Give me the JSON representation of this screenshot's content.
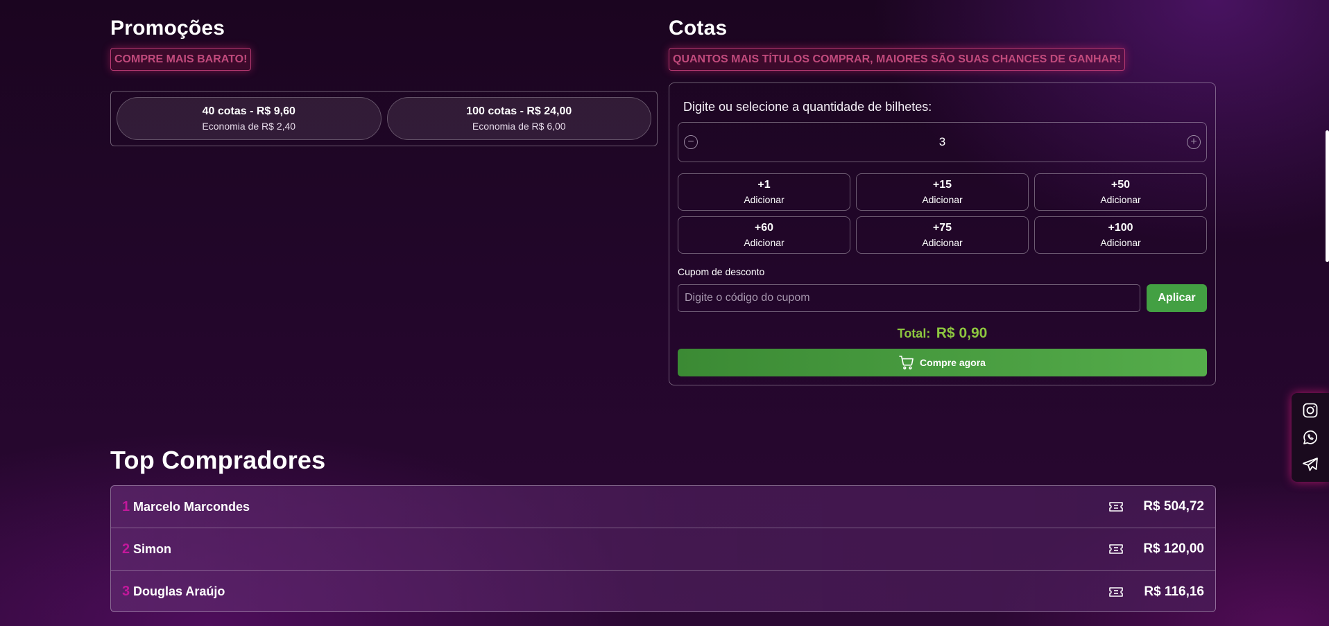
{
  "promocoes": {
    "title": "Promoções",
    "tag": "COMPRE MAIS BARATO!",
    "items": [
      {
        "title": "40 cotas - R$ 9,60",
        "subtitle": "Economia de R$ 2,40"
      },
      {
        "title": "100 cotas - R$ 24,00",
        "subtitle": "Economia de R$ 6,00"
      }
    ]
  },
  "cotas": {
    "title": "Cotas",
    "tag": "QUANTOS MAIS TÍTULOS COMPRAR, MAIORES SÃO SUAS CHANCES DE GANHAR!",
    "prompt": "Digite ou selecione a quantidade de bilhetes:",
    "quantity": "3",
    "minus_symbol": "−",
    "plus_symbol": "+",
    "add_buttons": [
      {
        "amount": "+1",
        "label": "Adicionar"
      },
      {
        "amount": "+15",
        "label": "Adicionar"
      },
      {
        "amount": "+50",
        "label": "Adicionar"
      },
      {
        "amount": "+60",
        "label": "Adicionar"
      },
      {
        "amount": "+75",
        "label": "Adicionar"
      },
      {
        "amount": "+100",
        "label": "Adicionar"
      }
    ],
    "coupon_label": "Cupom de desconto",
    "coupon_placeholder": "Digite o código do cupom",
    "coupon_value": "",
    "apply_label": "Aplicar",
    "total_label": "Total:",
    "total_value": "R$ 0,90",
    "buy_label": "Compre agora"
  },
  "top_compradores": {
    "title": "Top Compradores",
    "rows": [
      {
        "rank": "1",
        "name": "Marcelo Marcondes",
        "value": "R$ 504,72"
      },
      {
        "rank": "2",
        "name": "Simon",
        "value": "R$ 120,00"
      },
      {
        "rank": "3",
        "name": "Douglas Araújo",
        "value": "R$ 116,16"
      }
    ]
  },
  "social": [
    "instagram-icon",
    "whatsapp-icon",
    "telegram-icon"
  ],
  "colors": {
    "accent_green": "#43a043",
    "total_green": "#8dc63f",
    "tag_pink": "#c04a7c",
    "rank_magenta": "#c2189b",
    "background": "#22062a"
  }
}
